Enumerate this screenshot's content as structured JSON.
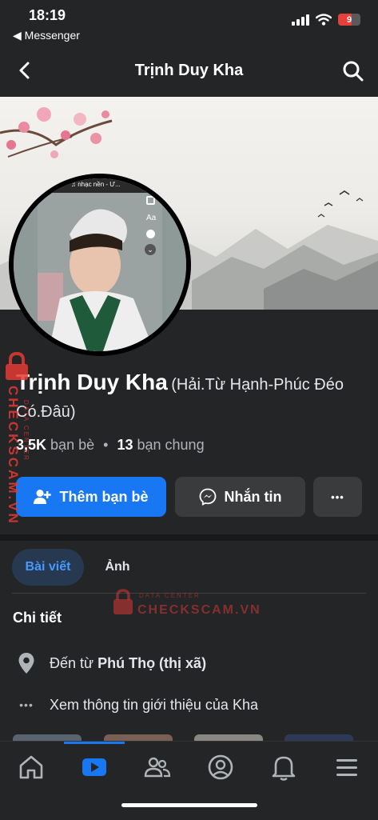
{
  "status_bar": {
    "time": "18:19",
    "back_app": "◀ Messenger",
    "battery": "9"
  },
  "header": {
    "title": "Trịnh Duy Kha"
  },
  "profile": {
    "name": "Trịnh Duy Kha",
    "alt_name": "(Hải.Từ Hạnh-Phúc Đéo Có.Đâū)",
    "friends_count": "3,5K",
    "friends_label": "bạn bè",
    "separator": "•",
    "mutual_count": "13",
    "mutual_label": "bạn chung",
    "avatar_overlay_text": "♫ nhạc nền - Ư...",
    "avatar_aa": "Aa"
  },
  "actions": {
    "add_friend": "Thêm bạn bè",
    "message": "Nhắn tin",
    "more": "•••"
  },
  "tabs": [
    {
      "label": "Bài viết"
    },
    {
      "label": "Ảnh"
    }
  ],
  "details": {
    "title": "Chi tiết",
    "from_prefix": "Đến từ",
    "from_place": "Phú Thọ (thị xã)",
    "about": "Xem thông tin giới thiệu của Kha"
  },
  "watermark": {
    "text": "CHECKSCAM.VN",
    "sub": "DATA CENTER"
  },
  "colors": {
    "accent": "#1877f2",
    "background": "#242526",
    "watermark": "#e53935"
  }
}
